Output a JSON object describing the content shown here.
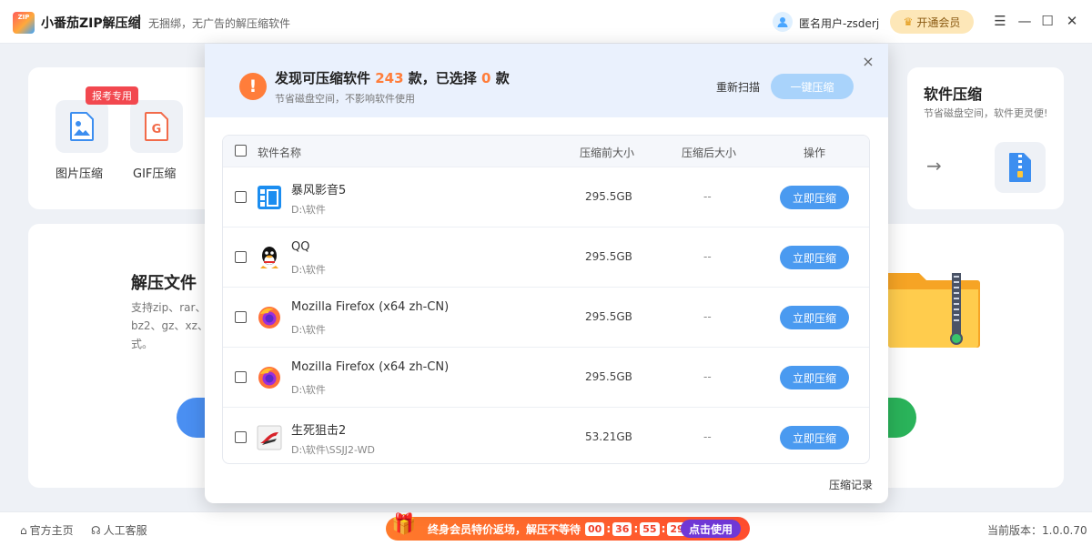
{
  "titlebar": {
    "logo_text": "ZIP",
    "app_title": "小番茄ZIP解压缩",
    "subtitle": "无捆绑，无广告的解压缩软件",
    "user_name": "匿名用户-zsderj",
    "vip_label": "开通会员",
    "controls": {
      "menu": "☰",
      "minimize": "—",
      "maximize": "☐",
      "close": "✕"
    }
  },
  "background": {
    "tools": [
      {
        "label": "图片压缩",
        "icon": "image-icon"
      },
      {
        "label": "GIF压缩",
        "icon": "gif-icon"
      }
    ],
    "exam_badge": "报考专用",
    "unzip": {
      "title": "解压文件",
      "desc_line1": "支持zip、rar、",
      "desc_line2": "bz2、gz、xz、",
      "desc_line3": "式。"
    },
    "software_compress": {
      "title": "软件压缩",
      "desc": "节省磁盘空间，软件更灵便!",
      "arrow": "→"
    }
  },
  "modal": {
    "title_prefix": "发现可压缩软件",
    "found_count": "243",
    "title_mid": "款，已选择",
    "selected_count": "0",
    "title_suffix": "款",
    "subtitle": "节省磁盘空间，不影响软件使用",
    "rescan_label": "重新扫描",
    "onekey_label": "一键压缩",
    "close": "×",
    "columns": {
      "name": "软件名称",
      "before": "压缩前大小",
      "after": "压缩后大小",
      "action": "操作"
    },
    "rows": [
      {
        "name": "暴风影音5",
        "path": "D:\\软件",
        "before": "295.5GB",
        "after": "--",
        "action": "立即压缩",
        "icon": "baofeng-icon"
      },
      {
        "name": "QQ",
        "path": "D:\\软件",
        "before": "295.5GB",
        "after": "--",
        "action": "立即压缩",
        "icon": "qq-icon"
      },
      {
        "name": "Mozilla Firefox (x64 zh-CN)",
        "path": "D:\\软件",
        "before": "295.5GB",
        "after": "--",
        "action": "立即压缩",
        "icon": "firefox-icon"
      },
      {
        "name": "Mozilla Firefox (x64 zh-CN)",
        "path": "D:\\软件",
        "before": "295.5GB",
        "after": "--",
        "action": "立即压缩",
        "icon": "firefox-icon"
      },
      {
        "name": "生死狙击2",
        "path": "D:\\软件\\SSJJ2-WD",
        "before": "53.21GB",
        "after": "--",
        "action": "立即压缩",
        "icon": "ssjj-icon"
      }
    ],
    "history_label": "压缩记录"
  },
  "footer": {
    "home_label": "官方主页",
    "service_label": "人工客服",
    "promo_text": "终身会员特价返场，解压不等待",
    "timer": [
      "00",
      "36",
      "55",
      "291"
    ],
    "promo_button": "点击使用",
    "version": "当前版本：1.0.0.70"
  },
  "colors": {
    "accent": "#4a9af0",
    "warning": "#ff7d3a",
    "vip": "#fde7b8",
    "promo": "#ff5a2c"
  }
}
